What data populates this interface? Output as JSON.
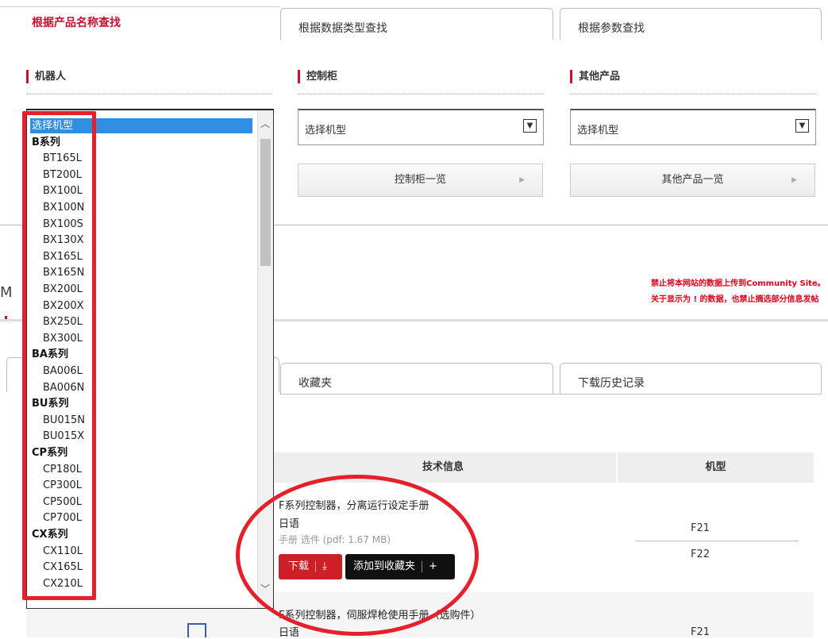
{
  "search_tabs": {
    "by_name": "根据产品名称查找",
    "by_type": "根据数据类型查找",
    "by_param": "根据参数查找"
  },
  "sections": {
    "robot": "机器人",
    "controller": "控制柜",
    "other": "其他产品"
  },
  "selects": {
    "controller_value": "选择机型",
    "other_value": "选择机型"
  },
  "buttons": {
    "controller_list": "控制柜一览",
    "other_list": "其他产品一览"
  },
  "warning": {
    "line1": "禁止将本网站的数据上传到Community Site。",
    "line2": "关于显示为 ! 的数据，也禁止摘选部分信息发帖"
  },
  "fav_tabs": {
    "favorites": "收藏夹",
    "history": "下载历史记录"
  },
  "table": {
    "col_info": "技术信息",
    "col_model": "机型"
  },
  "doc1": {
    "title": "F系列控制器，分离运行设定手册",
    "lang": "日语",
    "meta": "手册 选件 (pdf: 1.67 MB)",
    "download": "下载",
    "add_fav": "添加到收藏夹",
    "models": [
      "F21",
      "F22"
    ]
  },
  "doc2": {
    "title": "F系列控制器，伺服焊枪使用手册（选购件）",
    "lang": "日语",
    "model": "F21"
  },
  "left_fragment": "M",
  "robot_dropdown": [
    {
      "label": "选择机型",
      "kind": "selected"
    },
    {
      "label": "B系列",
      "kind": "group"
    },
    {
      "label": "BT165L",
      "kind": "opt"
    },
    {
      "label": "BT200L",
      "kind": "opt"
    },
    {
      "label": "BX100L",
      "kind": "opt"
    },
    {
      "label": "BX100N",
      "kind": "opt"
    },
    {
      "label": "BX100S",
      "kind": "opt"
    },
    {
      "label": "BX130X",
      "kind": "opt"
    },
    {
      "label": "BX165L",
      "kind": "opt"
    },
    {
      "label": "BX165N",
      "kind": "opt"
    },
    {
      "label": "BX200L",
      "kind": "opt"
    },
    {
      "label": "BX200X",
      "kind": "opt"
    },
    {
      "label": "BX250L",
      "kind": "opt"
    },
    {
      "label": "BX300L",
      "kind": "opt"
    },
    {
      "label": "BA系列",
      "kind": "group"
    },
    {
      "label": "BA006L",
      "kind": "opt"
    },
    {
      "label": "BA006N",
      "kind": "opt"
    },
    {
      "label": "BU系列",
      "kind": "group"
    },
    {
      "label": "BU015N",
      "kind": "opt"
    },
    {
      "label": "BU015X",
      "kind": "opt"
    },
    {
      "label": "CP系列",
      "kind": "group"
    },
    {
      "label": "CP180L",
      "kind": "opt"
    },
    {
      "label": "CP300L",
      "kind": "opt"
    },
    {
      "label": "CP500L",
      "kind": "opt"
    },
    {
      "label": "CP700L",
      "kind": "opt"
    },
    {
      "label": "CX系列",
      "kind": "group"
    },
    {
      "label": "CX110L",
      "kind": "opt"
    },
    {
      "label": "CX165L",
      "kind": "opt"
    },
    {
      "label": "CX210L",
      "kind": "opt"
    }
  ],
  "colors": {
    "brand_red": "#c8102e",
    "annotation_red": "#e5202b",
    "selection_blue": "#2f8ee0"
  }
}
